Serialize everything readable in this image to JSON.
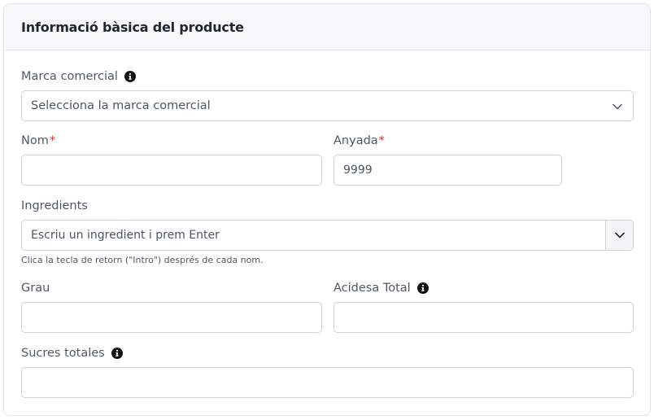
{
  "card": {
    "title": "Informació bàsica del producte"
  },
  "brand": {
    "label": "Marca comercial",
    "placeholder": "Selecciona la marca comercial"
  },
  "name": {
    "label": "Nom",
    "required_mark": "*",
    "value": ""
  },
  "vintage": {
    "label": "Anyada",
    "required_mark": "*",
    "placeholder": "9999"
  },
  "ingredients": {
    "label": "Ingredients",
    "placeholder": "Escriu un ingredient i prem Enter",
    "help": "Clica la tecla de retorn (\"Intro\") després de cada nom."
  },
  "degree": {
    "label": "Grau",
    "value": ""
  },
  "acidity": {
    "label": "Acidesa Total",
    "value": ""
  },
  "sugars": {
    "label": "Sucres totales",
    "value": ""
  },
  "colors": {
    "required": "#e02424",
    "border": "#ccd1d8",
    "header_bg": "#f7f8fa"
  },
  "icons": {
    "info": "info-circle-icon",
    "dropdown": "chevron-down-icon"
  }
}
